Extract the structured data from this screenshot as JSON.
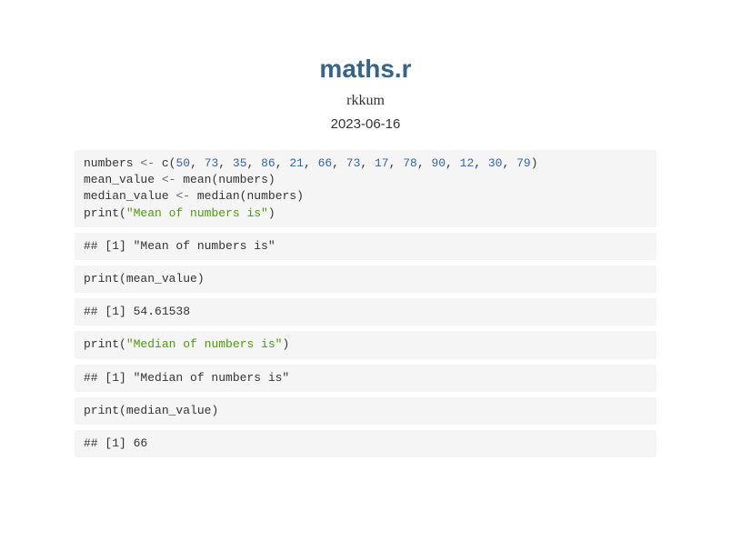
{
  "title": "maths.r",
  "author": "rkkum",
  "date": "2023-06-16",
  "code": {
    "numbers": [
      50,
      73,
      35,
      86,
      21,
      66,
      73,
      17,
      78,
      90,
      12,
      30,
      79
    ],
    "assign_op": "<-",
    "var_numbers": "numbers",
    "var_mean": "mean_value",
    "var_median": "median_value",
    "fn_c": "c",
    "fn_mean": "mean",
    "fn_median": "median",
    "fn_print": "print",
    "str_mean_label": "\"Mean of numbers is\"",
    "str_median_label": "\"Median of numbers is\""
  },
  "output": {
    "line1": "## [1] \"Mean of numbers is\"",
    "line2": "## [1] 54.61538",
    "line3": "## [1] \"Median of numbers is\"",
    "line4": "## [1] 66"
  }
}
